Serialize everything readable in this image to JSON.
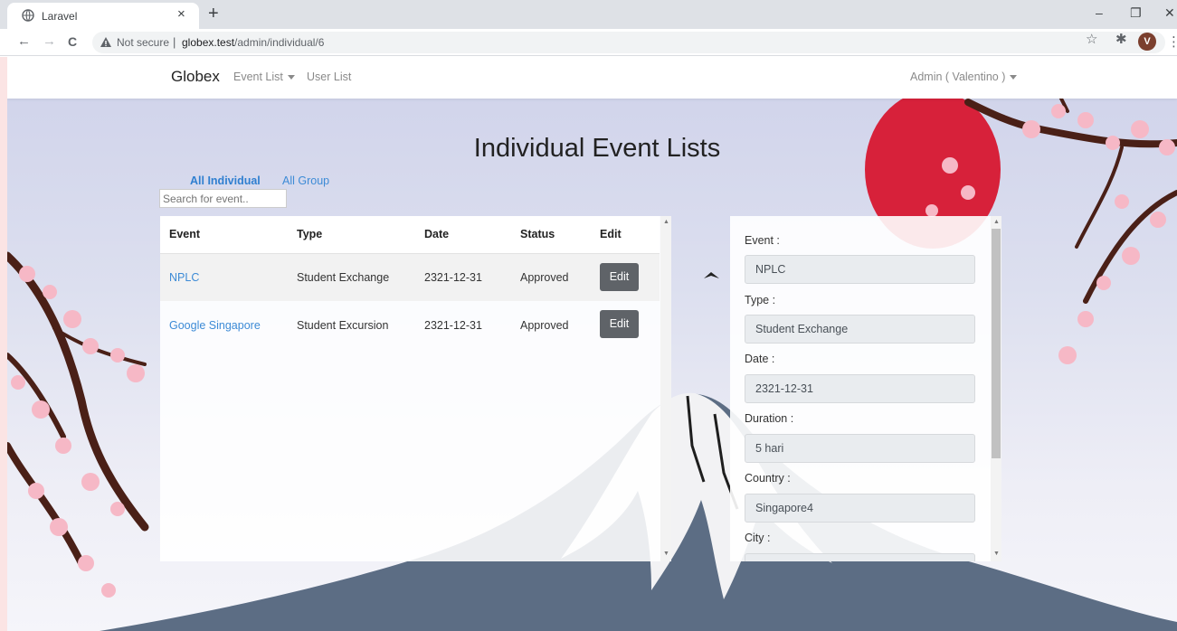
{
  "browser": {
    "tab_title": "Laravel",
    "tab_close": "×",
    "new_tab": "+",
    "window_controls": {
      "minimize": "–",
      "maximize": "❐",
      "close": "✕"
    },
    "nav": {
      "back": "←",
      "forward": "→",
      "reload": "C"
    },
    "security_label": "Not secure",
    "url_separator": "|",
    "url_host": "globex.test",
    "url_path": "/admin/individual/6",
    "avatar_letter": "V",
    "menu": "⋮",
    "star": "☆",
    "extensions": "✱"
  },
  "navbar": {
    "brand": "Globex",
    "event_list": "Event List",
    "user_list": "User List",
    "account": "Admin ( Valentino )"
  },
  "main": {
    "title": "Individual Event Lists",
    "filters": {
      "individual": "All Individual",
      "group": "All Group"
    },
    "search_placeholder": "Search for event.."
  },
  "table": {
    "headers": {
      "event": "Event",
      "type": "Type",
      "date": "Date",
      "status": "Status",
      "edit": "Edit"
    },
    "rows": [
      {
        "event": "NPLC",
        "type": "Student Exchange",
        "date": "2321-12-31",
        "status": "Approved",
        "edit": "Edit"
      },
      {
        "event": "Google Singapore",
        "type": "Student Excursion",
        "date": "2321-12-31",
        "status": "Approved",
        "edit": "Edit"
      }
    ]
  },
  "detail": {
    "event_label": "Event :",
    "event_value": "NPLC",
    "type_label": "Type :",
    "type_value": "Student Exchange",
    "date_label": "Date :",
    "date_value": "2321-12-31",
    "duration_label": "Duration :",
    "duration_value": "5 hari",
    "country_label": "Country :",
    "country_value": "Singapore4",
    "city_label": "City :"
  },
  "colors": {
    "link": "#3d8bd6",
    "sun": "#d7213a",
    "edit_button": "#5f6368",
    "mountain": "#5c6d84"
  }
}
